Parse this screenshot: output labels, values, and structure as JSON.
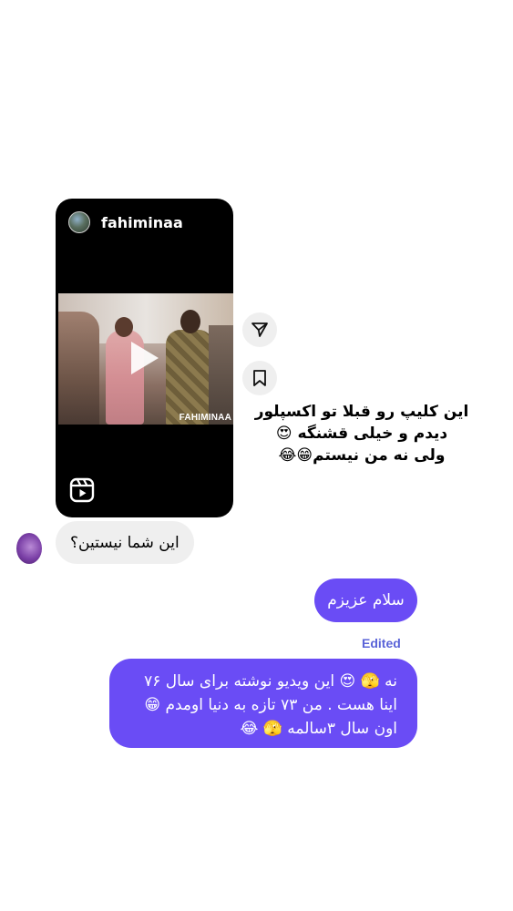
{
  "shared_reel": {
    "username": "fahiminaa",
    "watermark": "FAHIMINAA",
    "share_icon": "paper-plane-icon",
    "save_icon": "bookmark-icon",
    "reels_icon": "reels-icon"
  },
  "sticker_text": {
    "line1": "این کلیپ رو قبلا تو اکسپلور",
    "line2": "دیدم و خیلی قشنگه 😍",
    "line3": "ولی نه من نیستم😁😂"
  },
  "received_message": {
    "text": "این شما نیستین؟"
  },
  "sent_messages": [
    {
      "text": "سلام عزیزم"
    },
    {
      "edited_label": "Edited",
      "line1": "نه 🫣 😍 این ویدیو نوشته  برای سال ۷۶",
      "line2": "اینا هست . من ۷۳ تازه به دنیا اومدم 😁",
      "line3": "اون سال ۳سالمه 🫣 😂"
    }
  ],
  "colors": {
    "sent_bubble": "#6a4cf5",
    "received_bubble": "#efefef",
    "edited_label": "#5a63d8"
  }
}
